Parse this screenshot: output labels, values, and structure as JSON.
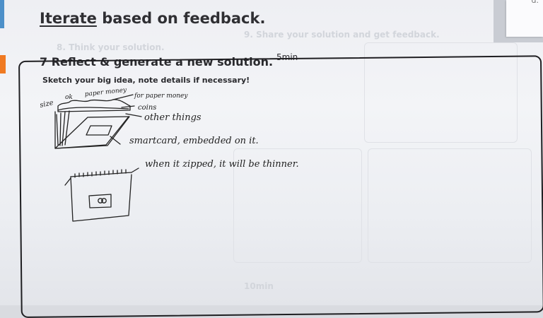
{
  "header": {
    "title_underlined": "Iterate",
    "title_rest": " based on feedback.",
    "corner_text": "d."
  },
  "step": {
    "number": "7",
    "title": "Reflect & generate a new solution.",
    "time": "5min",
    "instruction": "Sketch your big idea, note details if necessary!"
  },
  "ghost_text": {
    "line1": "9. Share your solution and get feedback.",
    "line2": "8. Think your solution.",
    "line3": "10min"
  },
  "sketch_notes": {
    "size": "size",
    "ok": "ok",
    "paper_money": "paper money",
    "for_paper_money": "for paper money",
    "coins": "coins",
    "other_things": "other things",
    "smartcard": "smartcard, embedded on it.",
    "zipped": "when it zipped, it will be thinner."
  },
  "colors": {
    "accent_orange": "#f07a22",
    "accent_blue": "#4d90c9",
    "ink": "#222222"
  }
}
